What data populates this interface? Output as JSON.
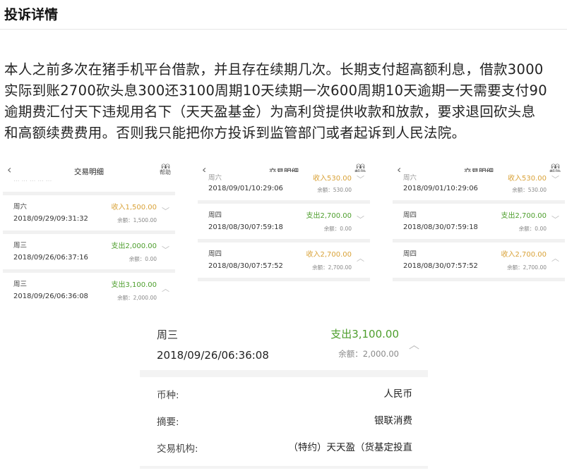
{
  "title": "投诉详情",
  "paragraph": [
    "本人之前多次在猪手机平台借款，并且存在续期几次。长期支付超高额利息，借款3000",
    "实际到账2700砍头息300还3100周期10天续期一次600周期10天逾期一天需要支付90",
    "逾期费汇付天下违规用名下（天天盈基金）为高利贷提供收款和放款，要求退回砍头息",
    "和高额续费费用。否则我只能把你方投诉到监管部门或者起诉到人民法院。"
  ],
  "panel": {
    "header_title": "交易明细",
    "back_icon": "‹",
    "help_glyph": "ᕱᕱ",
    "help_label": "帮助"
  },
  "panels": [
    {
      "top_partial": {
        "left": "··· ··· ··· ··· ···",
        "right": ""
      },
      "rows": [
        {
          "day": "周六",
          "datetime": "2018/09/29/09:31:32",
          "amount": "收入1,500.00",
          "type": "income",
          "balance": "余额：1,500.00"
        },
        {
          "day": "周三",
          "datetime": "2018/09/26/06:37:16",
          "amount": "支出2,000.00",
          "type": "expense",
          "balance": "余额：0.00"
        },
        {
          "day": "周三",
          "datetime": "2018/09/26/06:36:08",
          "amount": "支出3,100.00",
          "type": "expense",
          "balance": "余额：2,000.00"
        }
      ]
    },
    {
      "top_partial": {
        "left": "周六",
        "right": "收入530.00"
      },
      "rows": [
        {
          "day": "",
          "datetime": "2018/09/01/10:29:06",
          "amount": "",
          "type": "income",
          "balance": "余额：530.00"
        },
        {
          "day": "周四",
          "datetime": "2018/08/30/07:59:18",
          "amount": "支出2,700.00",
          "type": "expense",
          "balance": "余额：0.00"
        },
        {
          "day": "周四",
          "datetime": "2018/08/30/07:57:52",
          "amount": "收入2,700.00",
          "type": "income",
          "balance": "余额：2,700.00"
        }
      ]
    },
    {
      "top_partial": {
        "left": "周六",
        "right": "收入530.00"
      },
      "rows": [
        {
          "day": "",
          "datetime": "2018/09/01/10:29:06",
          "amount": "",
          "type": "income",
          "balance": "余额：530.00"
        },
        {
          "day": "周四",
          "datetime": "2018/08/30/07:59:18",
          "amount": "支出2,700.00",
          "type": "expense",
          "balance": "余额：0.00"
        },
        {
          "day": "周四",
          "datetime": "2018/08/30/07:57:52",
          "amount": "收入2,700.00",
          "type": "income",
          "balance": "余额：2,700.00"
        }
      ]
    }
  ],
  "detail": {
    "day": "周三",
    "datetime": "2018/09/26/06:36:08",
    "amount": "支出3,100.00",
    "balance": "余额：2,000.00",
    "fields": [
      {
        "key": "币种:",
        "value": "人民币"
      },
      {
        "key": "摘要:",
        "value": "银联消费"
      },
      {
        "key": "交易机构:",
        "value": "（特约）天天盈（货基定投直"
      }
    ]
  },
  "colors": {
    "income": "#d9a238",
    "expense": "#4d9e2c"
  }
}
